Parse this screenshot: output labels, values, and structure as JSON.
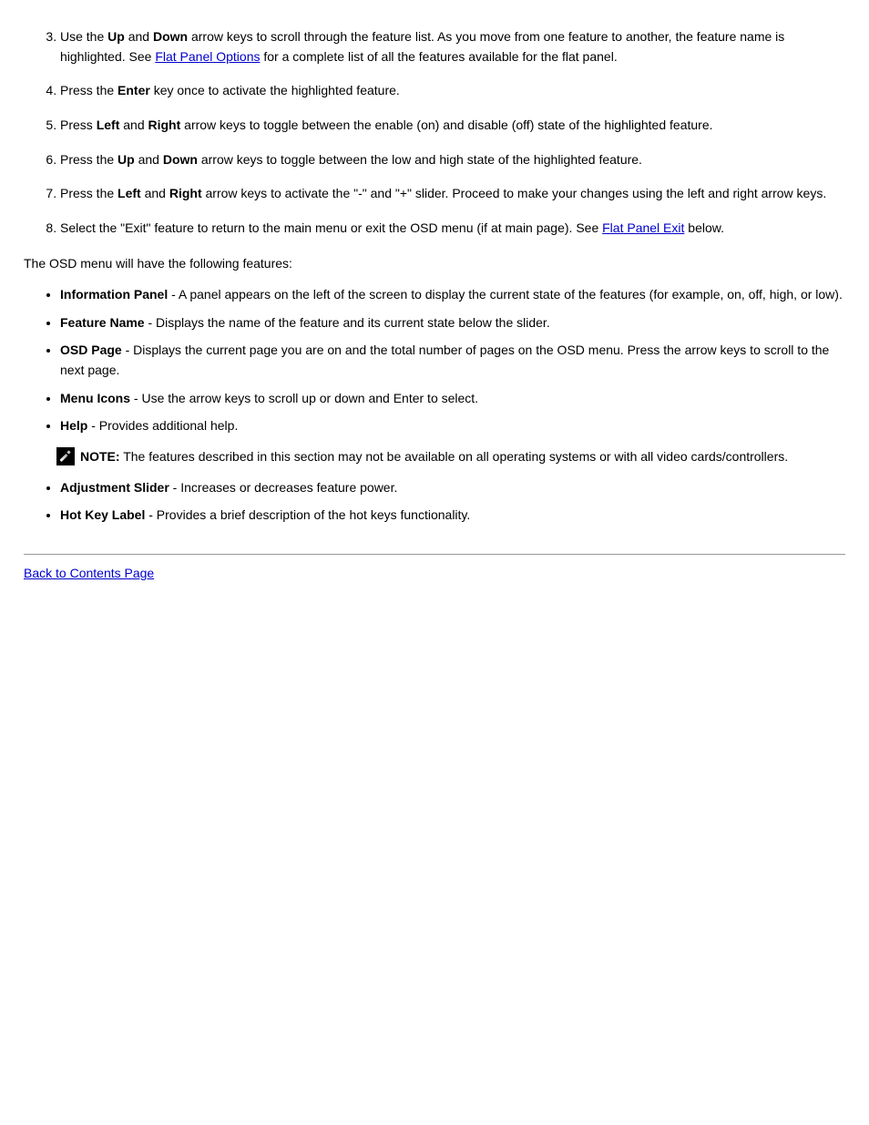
{
  "steps": [
    {
      "prefix": "Use the ",
      "bold1": "Up",
      "mid1": " and ",
      "bold2": "Down",
      "mid2": " arrow keys to scroll through the feature list. As you move from one feature to another, the feature name is highlighted. See ",
      "link": "Flat Panel Options",
      "suffix": " for a complete list of all the features available for the flat panel."
    },
    {
      "prefix": "Press the ",
      "bold1": "Enter",
      "suffix": " key once to activate the highlighted feature."
    },
    {
      "prefix": "Press ",
      "bold1": "Left",
      "mid1": " and ",
      "bold2": "Right",
      "suffix": " arrow keys to toggle between the enable (on) and disable (off) state of the highlighted feature."
    },
    {
      "prefix": "Press the ",
      "bold1": "Up",
      "mid1": " and ",
      "bold2": "Down",
      "suffix": " arrow keys to toggle between the low and high state of the highlighted feature."
    },
    {
      "prefix": "Press the ",
      "bold1": "Left",
      "mid1": " and ",
      "bold2": "Right",
      "suffix": " arrow keys to activate the \"-\" and \"+\" slider. Proceed to make your changes using the left and right arrow keys."
    },
    {
      "prefix": "Select the \"Exit\" feature to return to the main menu or exit the OSD menu (if at main page). See ",
      "link": "Flat Panel Exit",
      "suffix": " below."
    }
  ],
  "lower_desc": "The OSD menu will have the following features:",
  "features": [
    {
      "bold": "Information Panel",
      "suffix": " - A panel appears on the left of the screen to display the current state of the features (for example, on, off, high, or low)."
    },
    {
      "bold": "Feature Name",
      "suffix": " - Displays the name of the feature and its current state below the slider."
    },
    {
      "bold": "OSD Page",
      "suffix": " - Displays the current page you are on and the total number of pages on the OSD menu. Press the arrow keys to scroll to the next page."
    },
    {
      "bold": "Menu Icons",
      "suffix": " - Use the arrow keys to scroll up or down and Enter to select."
    },
    {
      "bold": "Help",
      "suffix": " - Provides additional help."
    }
  ],
  "note": {
    "label": "NOTE:",
    "text": " The features described in this section may not be available on all operating systems or with all video cards/controllers."
  },
  "features2": [
    {
      "bold": "Adjustment Slider",
      "suffix": " - Increases or decreases feature power."
    },
    {
      "bold": "Hot Key Label",
      "suffix": " - Provides a brief description of the hot keys functionality."
    }
  ],
  "back": "Back to Contents Page"
}
